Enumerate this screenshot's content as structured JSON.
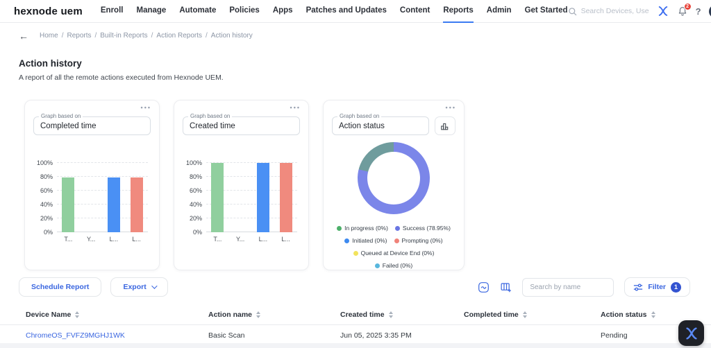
{
  "header": {
    "logo": "hexnode uem",
    "nav": [
      {
        "label": "Enroll"
      },
      {
        "label": "Manage"
      },
      {
        "label": "Automate"
      },
      {
        "label": "Policies"
      },
      {
        "label": "Apps"
      },
      {
        "label": "Patches and Updates"
      },
      {
        "label": "Content"
      },
      {
        "label": "Reports",
        "active": true
      },
      {
        "label": "Admin"
      },
      {
        "label": "Get Started"
      }
    ],
    "search_placeholder": "Search Devices, Use",
    "notification_count": "2",
    "help_label": "?",
    "icons": [
      "search-icon",
      "hexnode-mark-icon",
      "bell-icon",
      "help-icon",
      "avatar"
    ]
  },
  "breadcrumb": {
    "back_icon": "←",
    "items": [
      "Home",
      "Reports",
      "Built-in Reports",
      "Action Reports",
      "Action history"
    ]
  },
  "page": {
    "title": "Action history",
    "subtitle": "A report of all the remote actions executed from Hexnode UEM."
  },
  "cards": [
    {
      "label": "Graph based on",
      "value": "Completed time",
      "menu_icon": "more-dots-icon"
    },
    {
      "label": "Graph based on",
      "value": "Created time",
      "menu_icon": "more-dots-icon"
    },
    {
      "label": "Graph based on",
      "value": "Action status",
      "menu_icon": "more-dots-icon",
      "toggle_icon": "bar-chart-icon"
    }
  ],
  "chart_data": [
    {
      "type": "bar",
      "title": "Completed time",
      "categories": [
        "T...",
        "Y...",
        "L...",
        "L..."
      ],
      "values": [
        78.95,
        0,
        78.95,
        78.95
      ],
      "colors": [
        "#90cf9e",
        "#4a90f4",
        "#4a90f4",
        "#f08a7e"
      ],
      "ylim": [
        0,
        100
      ],
      "yticks": [
        "0%",
        "20%",
        "40%",
        "60%",
        "80%",
        "100%"
      ],
      "grid": "dashed"
    },
    {
      "type": "bar",
      "title": "Created time",
      "categories": [
        "T...",
        "Y...",
        "L...",
        "L..."
      ],
      "values": [
        100,
        0,
        100,
        100
      ],
      "colors": [
        "#90cf9e",
        "#4a90f4",
        "#4a90f4",
        "#f08a7e"
      ],
      "ylim": [
        0,
        100
      ],
      "yticks": [
        "0%",
        "20%",
        "40%",
        "60%",
        "80%",
        "100%"
      ],
      "grid": "dashed"
    },
    {
      "type": "donut",
      "title": "Action status",
      "segments": [
        {
          "label": "Success",
          "value": 78.95,
          "color": "#7b86e9"
        },
        {
          "label": "",
          "value": 21.05,
          "color": "#6f9c9d"
        }
      ],
      "legend": [
        {
          "label": "In progress (0%)",
          "color": "#4db06a"
        },
        {
          "label": "Success (78.95%)",
          "color": "#6a76e3"
        },
        {
          "label": "Initiated (0%)",
          "color": "#3d8af0"
        },
        {
          "label": "Prompting (0%)",
          "color": "#f0837a"
        },
        {
          "label": "Queued at Device End (0%)",
          "color": "#f2e35c"
        },
        {
          "label": "Failed (0%)",
          "color": "#58b7dd"
        }
      ],
      "legend_position": "bottom"
    }
  ],
  "toolbar": {
    "schedule_report_label": "Schedule Report",
    "export_label": "Export",
    "search_placeholder": "Search by name",
    "filter_label": "Filter",
    "filter_count": "1",
    "icons": [
      "report-graph-icon",
      "customize-columns-icon",
      "filter-sliders-icon"
    ]
  },
  "table": {
    "columns": [
      "Device Name",
      "Action name",
      "Created time",
      "Completed time",
      "Action status"
    ],
    "rows": [
      {
        "device_name": "ChromeOS_FVFZ9MGHJ1WK",
        "action_name": "Basic Scan",
        "created_time": "Jun 05, 2025 3:35 PM",
        "completed_time": "",
        "action_status": "Pending"
      }
    ]
  },
  "colors": {
    "accent_blue": "#3a66e0",
    "active_tab_underline": "#3a7af2",
    "bar_green": "#90cf9e",
    "bar_blue": "#4a90f4",
    "bar_salmon": "#f08a7e",
    "donut_purple": "#7b86e9",
    "donut_teal": "#6f9c9d",
    "notification_red": "#e8453c"
  }
}
